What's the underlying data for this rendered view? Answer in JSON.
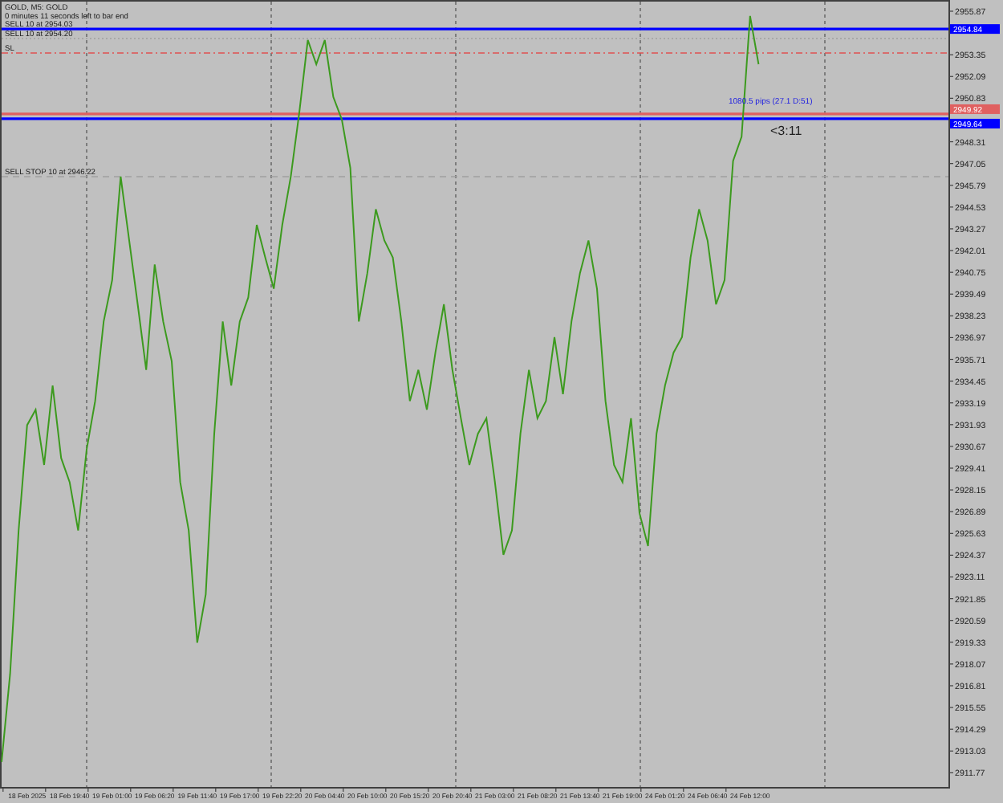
{
  "chart": {
    "timer": "0 minutes 11 seconds left to bar end",
    "countdown": "<3:11",
    "pips_label": "1080.5 pips (27.1 D:51)",
    "order_lines": [
      {
        "kind": "solid",
        "tag": "2954.84"
      },
      {
        "kind": "dotted"
      },
      {
        "kind": "dashdot"
      },
      {
        "kind": "solid",
        "tag": "2949.92"
      },
      {
        "kind": "solid",
        "tag": "2949.64"
      },
      {
        "kind": "dashed"
      }
    ],
    "chart_data": {
      "type": "line",
      "title": "GOLD, M5: GOLD",
      "ylim": [
        2910.95,
        2956.52
      ],
      "categories": [
        null,
        null,
        null,
        "18 Feb 2025",
        null,
        null,
        null,
        null,
        "18 Feb 19:40",
        null,
        null,
        null,
        null,
        "19 Feb 01:00",
        null,
        null,
        null,
        null,
        "19 Feb 06:20",
        null,
        null,
        null,
        null,
        "19 Feb 11:40",
        null,
        null,
        null,
        null,
        "19 Feb 17:00",
        null,
        null,
        null,
        null,
        "19 Feb 22:20",
        null,
        null,
        null,
        null,
        "20 Feb 04:40",
        null,
        null,
        null,
        null,
        "20 Feb 10:00",
        null,
        null,
        null,
        null,
        "20 Feb 15:20",
        null,
        null,
        null,
        null,
        "20 Feb 20:40",
        null,
        null,
        null,
        null,
        "21 Feb 03:00",
        null,
        null,
        null,
        null,
        "21 Feb 08:20",
        null,
        null,
        null,
        null,
        "21 Feb 13:40",
        null,
        null,
        null,
        null,
        "21 Feb 19:00",
        null,
        null,
        null,
        null,
        "24 Feb 01:20",
        null,
        null,
        null,
        null,
        "24 Feb 06:40",
        null,
        null,
        null,
        null,
        "24 Feb 12:00",
        null
      ],
      "series": [
        {
          "color": "#3c9a1e",
          "values": [
            2912.4,
            2917.5,
            2925.8,
            2931.9,
            2932.8,
            2929.6,
            2934.2,
            2930.0,
            2928.6,
            2925.8,
            2930.5,
            2933.3,
            2937.9,
            2940.3,
            2946.3,
            2942.6,
            2938.9,
            2935.1,
            2941.2,
            2937.9,
            2935.6,
            2928.6,
            2925.8,
            2919.3,
            2922.1,
            2931.4,
            2937.9,
            2934.2,
            2937.9,
            2939.3,
            2943.5,
            2941.6,
            2939.8,
            2943.5,
            2946.3,
            2950.0,
            2954.2,
            2952.8,
            2954.2,
            2950.9,
            2949.6,
            2946.8,
            2937.9,
            2940.7,
            2944.4,
            2942.6,
            2941.6,
            2937.9,
            2933.3,
            2935.1,
            2932.8,
            2936.1,
            2938.9,
            2935.1,
            2932.3,
            2929.6,
            2931.4,
            2932.3,
            2928.6,
            2924.4,
            2925.8,
            2931.4,
            2935.1,
            2932.3,
            2933.3,
            2937.0,
            2933.7,
            2937.9,
            2940.7,
            2942.6,
            2939.8,
            2933.3,
            2929.6,
            2928.6,
            2932.3,
            2926.8,
            2924.9,
            2931.4,
            2934.2,
            2936.1,
            2937.0,
            2941.6,
            2944.4,
            2942.6,
            2938.9,
            2940.3,
            2947.2,
            2948.6,
            2955.6,
            2952.8
          ]
        }
      ],
      "yticks": [
        2955.87,
        2953.35,
        2952.09,
        2950.83,
        2948.31,
        2947.05,
        2945.79,
        2944.53,
        2943.27,
        2942.01,
        2940.75,
        2939.49,
        2938.23,
        2936.97,
        2935.71,
        2934.45,
        2933.19,
        2931.93,
        2930.67,
        2929.41,
        2928.15,
        2926.89,
        2925.63,
        2924.37,
        2923.11,
        2921.85,
        2920.59,
        2919.33,
        2918.07,
        2916.81,
        2915.55,
        2914.29,
        2913.03,
        2911.77
      ],
      "ref_lines": [
        {
          "axis": "y",
          "value": 2954.84,
          "color": "#0000ff",
          "label": "SELL 10 at 2954.03"
        },
        {
          "axis": "y",
          "value": 2954.29,
          "color": "#a0a0a0",
          "label": "SELL 10 at 2954.20"
        },
        {
          "axis": "y",
          "value": 2953.45,
          "color": "#e05050",
          "label": "SL"
        },
        {
          "axis": "y",
          "value": 2949.92,
          "color": "#e06060"
        },
        {
          "axis": "y",
          "value": 2949.64,
          "color": "#0000ff"
        },
        {
          "axis": "y",
          "value": 2946.29,
          "color": "#a0a0a0",
          "label": "SELL STOP 10 at 2946.22"
        }
      ]
    }
  }
}
